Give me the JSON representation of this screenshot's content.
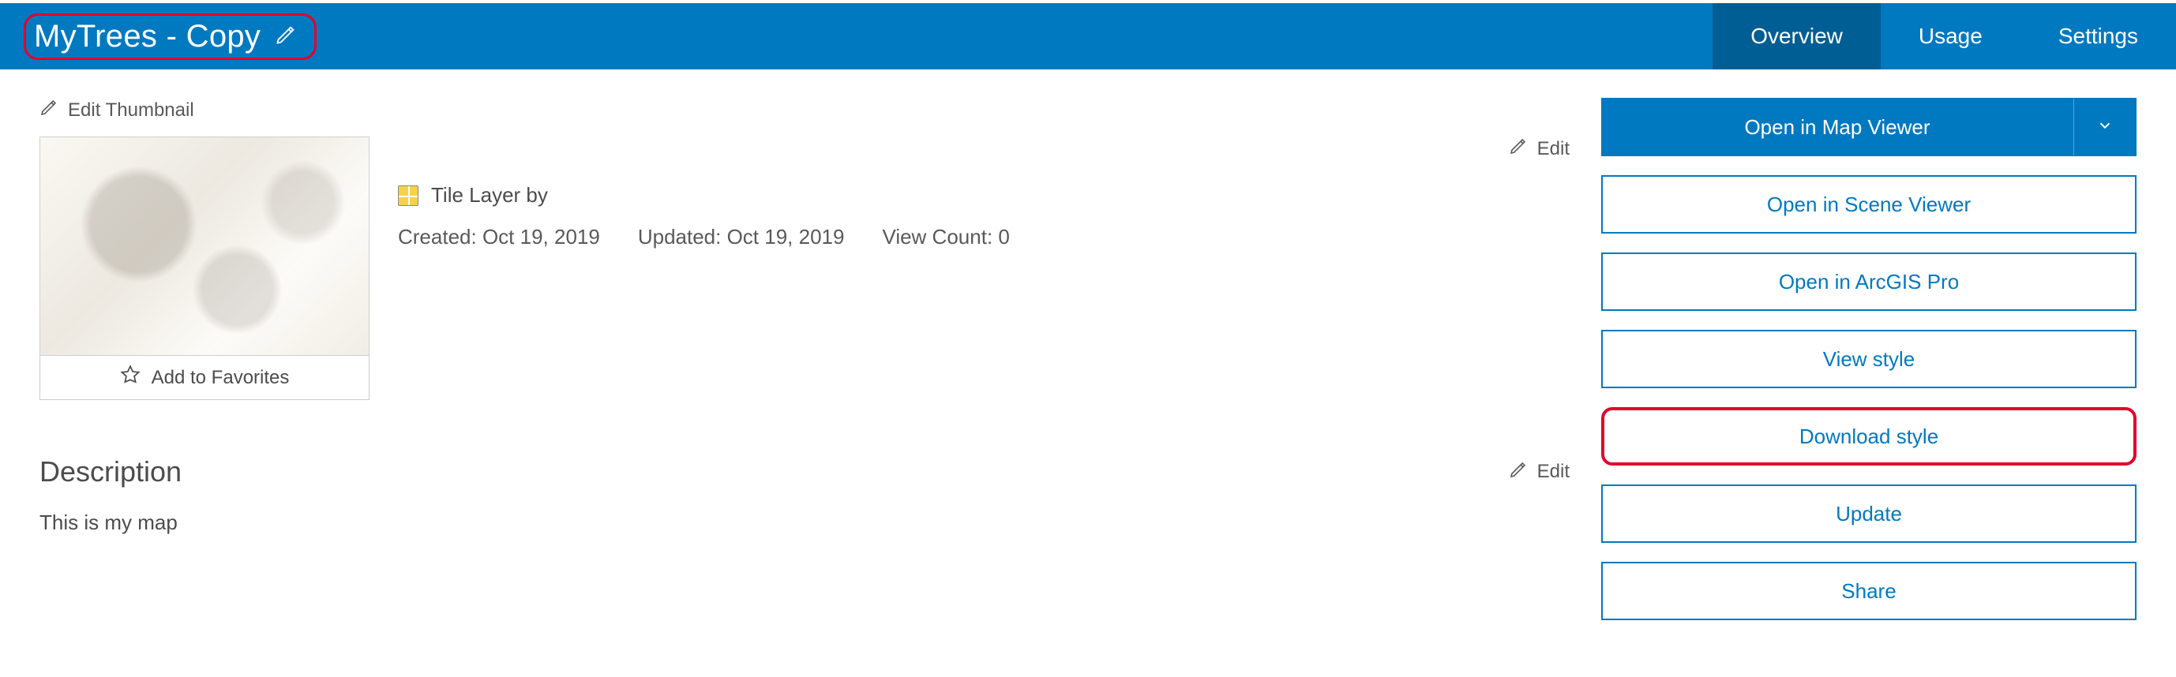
{
  "header": {
    "title": "MyTrees - Copy",
    "tabs": [
      {
        "label": "Overview",
        "active": true
      },
      {
        "label": "Usage",
        "active": false
      },
      {
        "label": "Settings",
        "active": false
      }
    ]
  },
  "main": {
    "edit_thumbnail_label": "Edit Thumbnail",
    "favorites_label": "Add to Favorites",
    "edit_label": "Edit",
    "item_type_prefix": "Tile Layer by",
    "owner": "",
    "created_label": "Created: Oct 19, 2019",
    "updated_label": "Updated: Oct 19, 2019",
    "view_count_label": "View Count: 0",
    "description_heading": "Description",
    "description_body": "This is my map"
  },
  "sidebar": {
    "primary_button": "Open in Map Viewer",
    "buttons": [
      "Open in Scene Viewer",
      "Open in ArcGIS Pro",
      "View style",
      "Download style",
      "Update",
      "Share"
    ],
    "highlight_index": 3
  }
}
